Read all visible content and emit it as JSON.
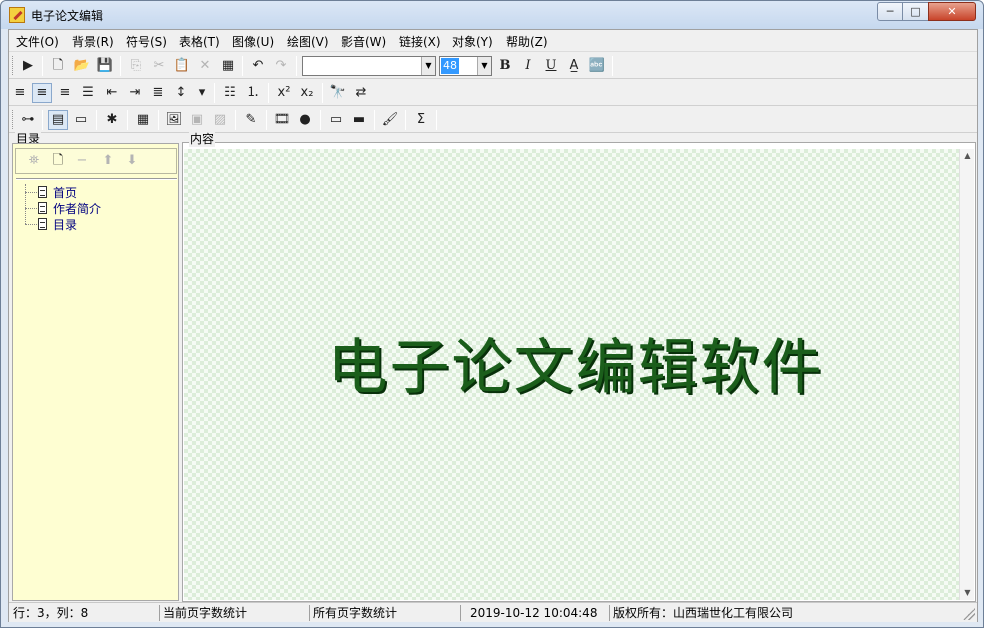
{
  "window": {
    "title": "电子论文编辑",
    "minimize_glyph": "─",
    "maximize_glyph": "□",
    "close_glyph": "✕"
  },
  "menu": [
    {
      "label": "文件(O)"
    },
    {
      "label": "背景(R)"
    },
    {
      "label": "符号(S)"
    },
    {
      "label": "表格(T)"
    },
    {
      "label": "图像(U)"
    },
    {
      "label": "绘图(V)"
    },
    {
      "label": "影音(W)"
    },
    {
      "label": "链接(X)"
    },
    {
      "label": "对象(Y)"
    },
    {
      "label": "帮助(Z)"
    }
  ],
  "toolbar1": {
    "font_name_value": "",
    "font_size_value": "48",
    "bold_label": "B",
    "italic_label": "I",
    "underline_label": "U"
  },
  "left_panel": {
    "label": "目录",
    "items": [
      {
        "label": "首页"
      },
      {
        "label": "作者简介"
      },
      {
        "label": "目录"
      }
    ]
  },
  "content_panel": {
    "label": "内容",
    "document_title": "电子论文编辑软件"
  },
  "statusbar": {
    "position": "行：3，列：8",
    "page_word_count": "当前页字数统计",
    "all_word_count": "所有页字数统计",
    "datetime": "2019-10-12 10:04:48",
    "copyright": "版权所有：山西瑞世化工有限公司"
  },
  "colors": {
    "title_text": "#1b5e1b",
    "tree_background": "#fefed2",
    "canvas_pattern": "#dcedd9"
  }
}
